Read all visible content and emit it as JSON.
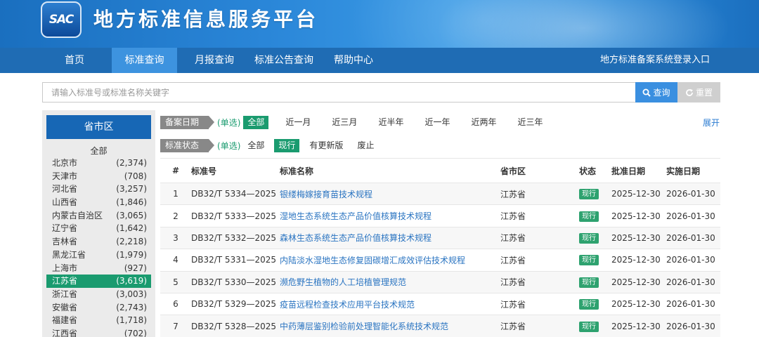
{
  "header": {
    "logo_text": "SAC",
    "title": "地方标准信息服务平台"
  },
  "nav": {
    "items": [
      {
        "label": "首页",
        "active": false
      },
      {
        "label": "标准查询",
        "active": true
      },
      {
        "label": "月报查询",
        "active": false
      },
      {
        "label": "标准公告查询",
        "active": false
      },
      {
        "label": "帮助中心",
        "active": false
      }
    ],
    "right_link": "地方标准备案系统登录入口"
  },
  "search": {
    "placeholder": "请输入标准号或标准名称关键字",
    "value": "",
    "query_label": "查询",
    "reset_label": "重置"
  },
  "sidebar": {
    "title": "省市区",
    "all_label": "全部",
    "regions": [
      {
        "name": "北京市",
        "count": "(2,374)"
      },
      {
        "name": "天津市",
        "count": "(708)"
      },
      {
        "name": "河北省",
        "count": "(3,257)"
      },
      {
        "name": "山西省",
        "count": "(1,846)"
      },
      {
        "name": "内蒙古自治区",
        "count": "(3,065)"
      },
      {
        "name": "辽宁省",
        "count": "(1,642)"
      },
      {
        "name": "吉林省",
        "count": "(2,218)"
      },
      {
        "name": "黑龙江省",
        "count": "(1,979)"
      },
      {
        "name": "上海市",
        "count": "(927)"
      },
      {
        "name": "江苏省",
        "count": "(3,619)",
        "selected": true
      },
      {
        "name": "浙江省",
        "count": "(3,003)"
      },
      {
        "name": "安徽省",
        "count": "(2,743)"
      },
      {
        "name": "福建省",
        "count": "(1,718)"
      },
      {
        "name": "江西省",
        "count": "(702)"
      }
    ]
  },
  "filters": {
    "date": {
      "label": "备案日期",
      "mode": "(单选)",
      "options": [
        "全部",
        "近一月",
        "近三月",
        "近半年",
        "近一年",
        "近两年",
        "近三年"
      ],
      "selected": "全部"
    },
    "status": {
      "label": "标准状态",
      "mode": "(单选)",
      "options": [
        "全部",
        "现行",
        "有更新版",
        "废止"
      ],
      "selected": "现行"
    },
    "expand_label": "展开"
  },
  "table": {
    "headers": [
      "#",
      "标准号",
      "标准名称",
      "省市区",
      "状态",
      "批准日期",
      "实施日期"
    ],
    "rows": [
      {
        "idx": "1",
        "code": "DB32/T 5334—2025",
        "name": "银缕梅嫁接育苗技术规程",
        "province": "江苏省",
        "status": "现行",
        "approved": "2025-12-30",
        "effective": "2026-01-30"
      },
      {
        "idx": "2",
        "code": "DB32/T 5333—2025",
        "name": "湿地生态系统生态产品价值核算技术规程",
        "province": "江苏省",
        "status": "现行",
        "approved": "2025-12-30",
        "effective": "2026-01-30"
      },
      {
        "idx": "3",
        "code": "DB32/T 5332—2025",
        "name": "森林生态系统生态产品价值核算技术规程",
        "province": "江苏省",
        "status": "现行",
        "approved": "2025-12-30",
        "effective": "2026-01-30"
      },
      {
        "idx": "4",
        "code": "DB32/T 5331—2025",
        "name": "内陆淡水湿地生态修复固碳增汇成效评估技术规程",
        "province": "江苏省",
        "status": "现行",
        "approved": "2025-12-30",
        "effective": "2026-01-30"
      },
      {
        "idx": "5",
        "code": "DB32/T 5330—2025",
        "name": "濒危野生植物的人工培植管理规范",
        "province": "江苏省",
        "status": "现行",
        "approved": "2025-12-30",
        "effective": "2026-01-30"
      },
      {
        "idx": "6",
        "code": "DB32/T 5329—2025",
        "name": "疫苗远程检查技术应用平台技术规范",
        "province": "江苏省",
        "status": "现行",
        "approved": "2025-12-30",
        "effective": "2026-01-30"
      },
      {
        "idx": "7",
        "code": "DB32/T 5328—2025",
        "name": "中药薄层鉴别检验前处理智能化系统技术规范",
        "province": "江苏省",
        "status": "现行",
        "approved": "2025-12-30",
        "effective": "2026-01-30"
      }
    ]
  },
  "colors": {
    "nav_bg": "#1f6cb4",
    "nav_active": "#3d93df",
    "accent_green": "#1a9b6f",
    "link_blue": "#2a74c1"
  }
}
